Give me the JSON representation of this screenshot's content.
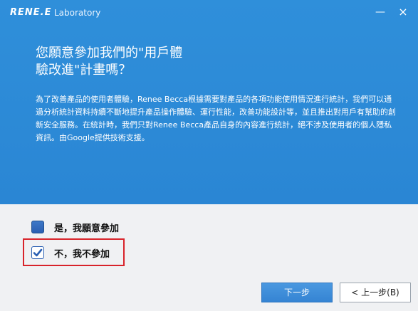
{
  "titlebar": {
    "logo": "RENE.E",
    "app_name": "Laboratory",
    "minimize_glyph": "—",
    "close_glyph": "×"
  },
  "main": {
    "headline": "您願意參加我們的\"用戶體\n驗改進\"計畫嗎？",
    "description": "為了改善產品的使用者體驗，Renee Becca根據需要對產品的各項功能使用情況進行統計，我們可以通過分析統計資料持續不斷地提升產品操作體驗、運行性能，改善功能設計等，並且推出對用戶有幫助的創新安全服務。在統計時，我們只對Renee Becca產品自身的內容進行統計，絕不涉及使用者的個人隱私資訊。由Google提供技術支援。"
  },
  "options": {
    "yes_label": "是，我願意參加",
    "yes_checked": false,
    "no_label": "不，我不參加",
    "no_checked": true
  },
  "buttons": {
    "next": "下一步",
    "prev": "< 上一步(B)"
  },
  "colors": {
    "header_blue": "#2b89d6",
    "checkbox_blue": "#2a5fb2",
    "highlight_red": "#d8232a",
    "button_blue": "#3d8ddb"
  }
}
